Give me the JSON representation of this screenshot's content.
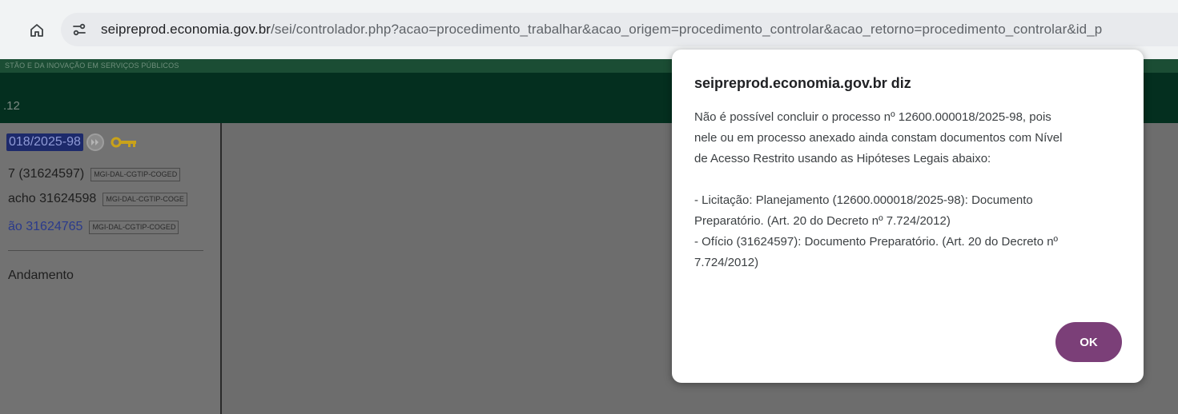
{
  "browser": {
    "url_host": "seipreprod.economia.gov.br",
    "url_rest": "/sei/controlador.php?acao=procedimento_trabalhar&acao_origem=procedimento_controlar&acao_retorno=procedimento_controlar&id_p"
  },
  "page": {
    "banner_text": "STÃO E DA INOVAÇÃO EM SERVIÇOS PÚBLICOS",
    "version": ".12",
    "tree": {
      "process_number": "018/2025-98",
      "documents": [
        {
          "label": "7 (31624597)",
          "unit": "MGI-DAL-CGTIP-COGED"
        },
        {
          "label": "acho 31624598",
          "unit": "MGI-DAL-CGTIP-COGE"
        },
        {
          "label": "ão 31624765",
          "unit": "MGI-DAL-CGTIP-COGED"
        }
      ],
      "andamento": "Andamento"
    }
  },
  "dialog": {
    "title": "seipreprod.economia.gov.br diz",
    "lines": [
      "Não é possível concluir o processo nº 12600.000018/2025-98, pois",
      "nele ou em processo anexado ainda constam documentos com Nível",
      "de Acesso Restrito usando as Hipóteses Legais abaixo:",
      "",
      "-  Licitação: Planejamento (12600.000018/2025-98): Documento",
      "Preparatório. (Art. 20 do Decreto nº 7.724/2012)",
      "-  Ofício (31624597): Documento Preparatório. (Art. 20 do Decreto nº",
      "7.724/2012)"
    ],
    "ok_label": "OK"
  },
  "colors": {
    "ok_button": "#7b3f78",
    "header": "#042f1f",
    "banner": "#1b4d34"
  },
  "icons": {
    "home": "home-icon",
    "site_info": "tune-icon",
    "process_action": "forward-circle-icon",
    "access": "key-icon"
  }
}
